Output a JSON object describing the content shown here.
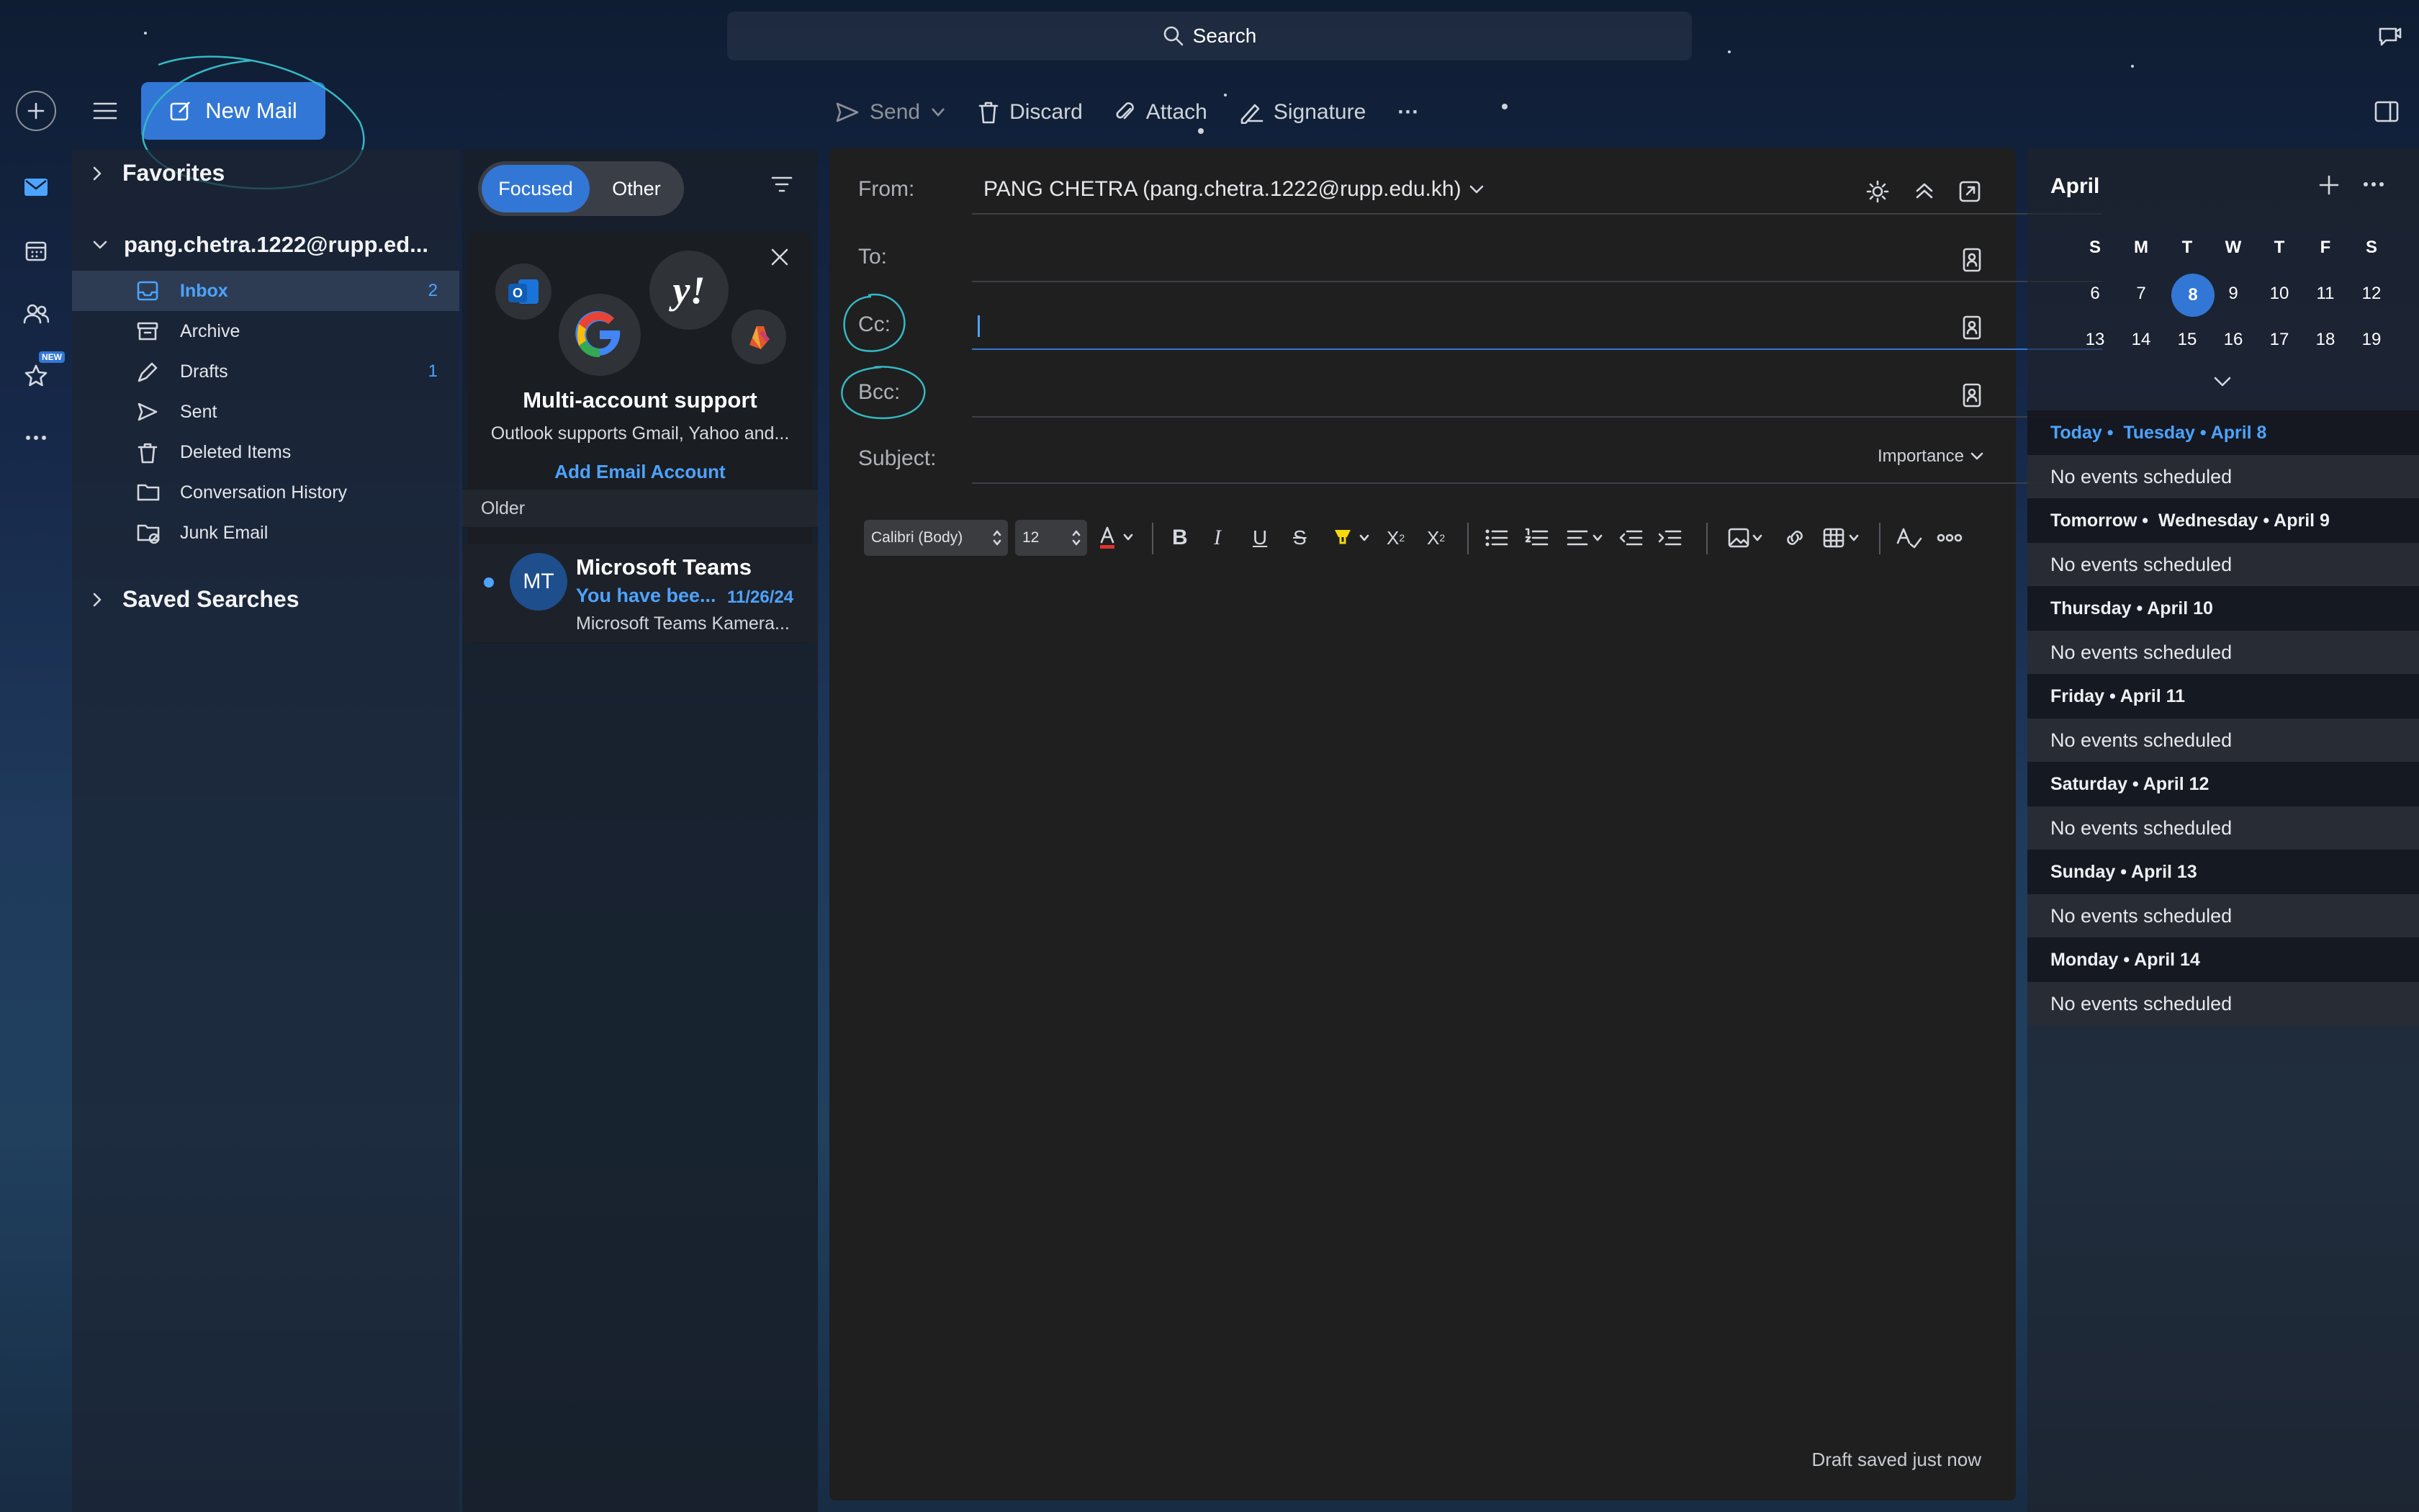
{
  "search": {
    "label": "Search"
  },
  "compose_button": {
    "label": "New Mail"
  },
  "toolbar": {
    "send": "Send",
    "discard": "Discard",
    "attach": "Attach",
    "signature": "Signature",
    "more": "···"
  },
  "rail": {
    "new_badge": "NEW"
  },
  "folders": {
    "favorites": "Favorites",
    "account": "pang.chetra.1222@rupp.ed...",
    "items": [
      {
        "label": "Inbox",
        "count": "2",
        "icon": "inbox-icon"
      },
      {
        "label": "Archive",
        "count": "",
        "icon": "archive-icon"
      },
      {
        "label": "Drafts",
        "count": "1",
        "icon": "pencil-icon"
      },
      {
        "label": "Sent",
        "count": "",
        "icon": "send-icon"
      },
      {
        "label": "Deleted Items",
        "count": "",
        "icon": "trash-icon"
      },
      {
        "label": "Conversation History",
        "count": "",
        "icon": "folder-icon"
      },
      {
        "label": "Junk Email",
        "count": "",
        "icon": "junk-icon"
      }
    ],
    "saved_searches": "Saved Searches"
  },
  "list": {
    "focused": "Focused",
    "other": "Other",
    "promo": {
      "title": "Multi-account support",
      "desc": "Outlook supports Gmail, Yahoo and...",
      "action": "Add Email Account"
    },
    "group": "Older",
    "messages": [
      {
        "initials": "MT",
        "sender": "Microsoft Teams",
        "subject": "You have bee...",
        "date": "11/26/24",
        "preview": "Microsoft Teams Kamera..."
      }
    ]
  },
  "compose": {
    "from_label": "From:",
    "from_value": "PANG CHETRA (pang.chetra.1222@rupp.edu.kh)",
    "to_label": "To:",
    "cc_label": "Cc:",
    "bcc_label": "Bcc:",
    "subject_label": "Subject:",
    "importance": "Importance",
    "font": "Calibri (Body)",
    "size": "12",
    "status": "Draft saved just now"
  },
  "calendar": {
    "month": "April",
    "weekdays": [
      "S",
      "M",
      "T",
      "W",
      "T",
      "F",
      "S"
    ],
    "weeks": [
      [
        "6",
        "7",
        "8",
        "9",
        "10",
        "11",
        "12"
      ],
      [
        "13",
        "14",
        "15",
        "16",
        "17",
        "18",
        "19"
      ]
    ],
    "selected": "8",
    "agenda": [
      {
        "prefix": "Today •",
        "title": "Tuesday • April 8",
        "empty": "No events scheduled"
      },
      {
        "prefix": "Tomorrow •",
        "title": "Wednesday • April 9",
        "empty": "No events scheduled"
      },
      {
        "prefix": "",
        "title": "Thursday • April 10",
        "empty": "No events scheduled"
      },
      {
        "prefix": "",
        "title": "Friday • April 11",
        "empty": "No events scheduled"
      },
      {
        "prefix": "",
        "title": "Saturday • April 12",
        "empty": "No events scheduled"
      },
      {
        "prefix": "",
        "title": "Sunday • April 13",
        "empty": "No events scheduled"
      },
      {
        "prefix": "",
        "title": "Monday • April 14",
        "empty": "No events scheduled"
      }
    ]
  },
  "colors": {
    "accent": "#3277d6",
    "link": "#4da3ff",
    "annotation": "#35b8c4"
  }
}
